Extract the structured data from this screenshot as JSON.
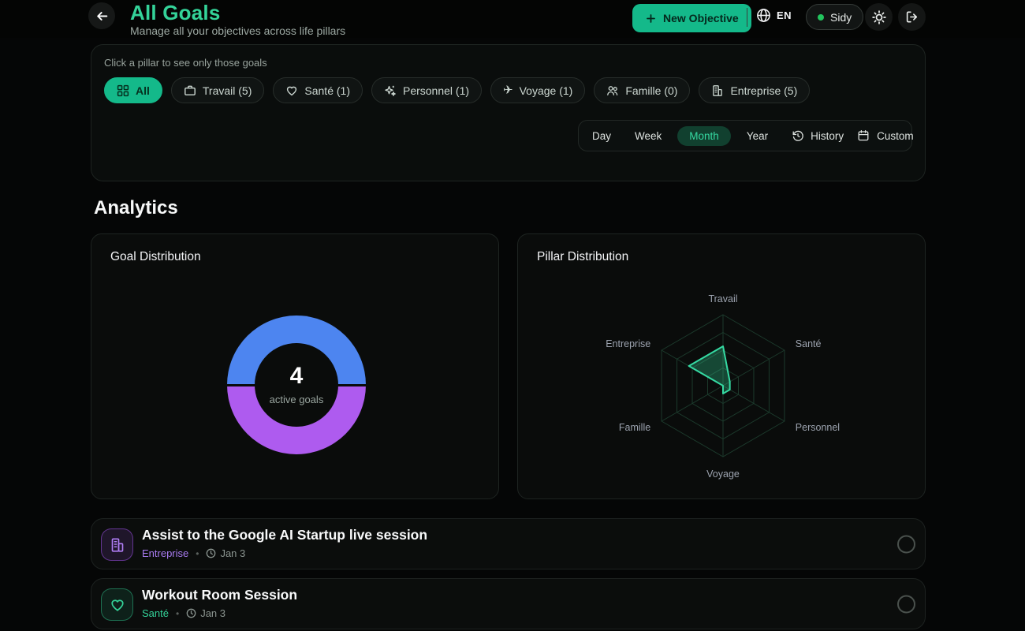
{
  "header": {
    "title": "All Goals",
    "subtitle": "Manage all your objectives across life pillars",
    "new_objective_label": "New Objective",
    "language": "EN",
    "user_name": "Sidy"
  },
  "filters": {
    "hint": "Click a pillar to see only those goals",
    "pills": [
      {
        "label": "All",
        "icon": "grid-icon",
        "active": true
      },
      {
        "label": "Travail (5)",
        "icon": "briefcase-icon",
        "active": false
      },
      {
        "label": "Santé (1)",
        "icon": "heart-icon",
        "active": false
      },
      {
        "label": "Personnel (1)",
        "icon": "sparkles-icon",
        "active": false
      },
      {
        "label": "Voyage (1)",
        "icon": "plane-icon",
        "active": false
      },
      {
        "label": "Famille (0)",
        "icon": "people-icon",
        "active": false
      },
      {
        "label": "Entreprise (5)",
        "icon": "building-icon",
        "active": false
      }
    ],
    "time_ranges": [
      "Day",
      "Week",
      "Month",
      "Year"
    ],
    "selected_range": "Month",
    "history_label": "History",
    "custom_label": "Custom"
  },
  "analytics": {
    "heading": "Analytics",
    "goal_card_title": "Goal Distribution",
    "pillar_card_title": "Pillar Distribution"
  },
  "chart_data": [
    {
      "type": "pie",
      "title": "Goal Distribution",
      "donut": true,
      "center_label": "4",
      "center_sublabel": "active goals",
      "segments": [
        {
          "name": "top-half",
          "value": 2,
          "color": "#4d85f0"
        },
        {
          "name": "bottom-half",
          "value": 2,
          "color": "#ae5bef"
        }
      ]
    },
    {
      "type": "radar",
      "title": "Pillar Distribution",
      "categories": [
        "Travail",
        "Santé",
        "Personnel",
        "Voyage",
        "Famille",
        "Entreprise"
      ],
      "values": [
        5,
        1,
        1,
        1,
        0,
        5
      ],
      "scale_max": 9,
      "grid_levels": 4,
      "grid_color": "#1c3a2c",
      "stroke_color": "#35d9a2",
      "fill_color": "rgba(52,211,153,0.3)",
      "label_color": "#9ca3af"
    }
  ],
  "goals": [
    {
      "title": "Assist to the Google AI Startup live session",
      "pillar": "Entreprise",
      "separator": "•",
      "date": "Jan 3",
      "color": "#a855f7"
    },
    {
      "title": "Workout Room Session",
      "pillar": "Santé",
      "separator": "•",
      "date": "Jan 3",
      "color": "#34d399"
    }
  ],
  "colors": {
    "accent_green": "#14b98a",
    "title_green": "#34d399",
    "donut_blue": "#4d85f0",
    "donut_purple": "#ae5bef"
  }
}
